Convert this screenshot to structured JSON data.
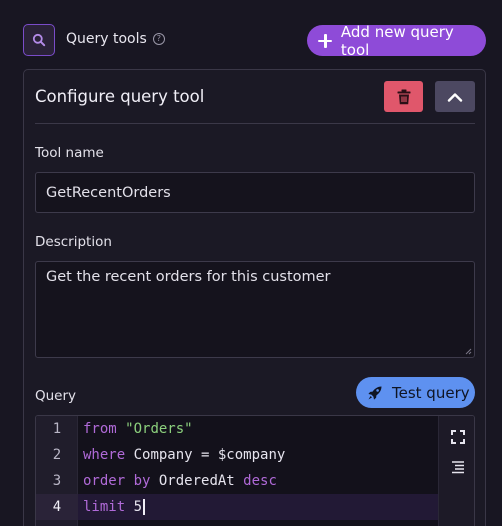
{
  "header": {
    "title": "Query tools",
    "add_button_label": "Add new query tool"
  },
  "card": {
    "title": "Configure query tool",
    "tool_name_label": "Tool name",
    "tool_name_value": "GetRecentOrders",
    "description_label": "Description",
    "description_value": "Get the recent orders for this customer",
    "query_label": "Query",
    "test_button_label": "Test query"
  },
  "editor": {
    "line_numbers": [
      "1",
      "2",
      "3",
      "4"
    ],
    "active_line": 4,
    "lines": [
      [
        {
          "t": "from",
          "c": "kw"
        },
        {
          "t": " ",
          "c": "plain"
        },
        {
          "t": "\"Orders\"",
          "c": "str"
        }
      ],
      [
        {
          "t": "where",
          "c": "kw"
        },
        {
          "t": " Company = $company",
          "c": "plain"
        }
      ],
      [
        {
          "t": "order by",
          "c": "kw"
        },
        {
          "t": " OrderedAt ",
          "c": "plain"
        },
        {
          "t": "desc",
          "c": "kw"
        }
      ],
      [
        {
          "t": "limit",
          "c": "kw"
        },
        {
          "t": " 5",
          "c": "plain"
        }
      ]
    ]
  },
  "colors": {
    "accent_purple": "#8e4bd8",
    "delete_red": "#e0576b",
    "test_blue": "#5e91f0",
    "keyword": "#b06ad8",
    "string": "#8cd07d"
  },
  "icons": {
    "header_icon": "search-icon",
    "help": "help-icon",
    "add": "plus-icon",
    "delete": "trash-icon",
    "collapse": "chevron-up-icon",
    "test": "rocket-icon",
    "fullscreen": "fullscreen-icon",
    "format": "format-icon"
  }
}
